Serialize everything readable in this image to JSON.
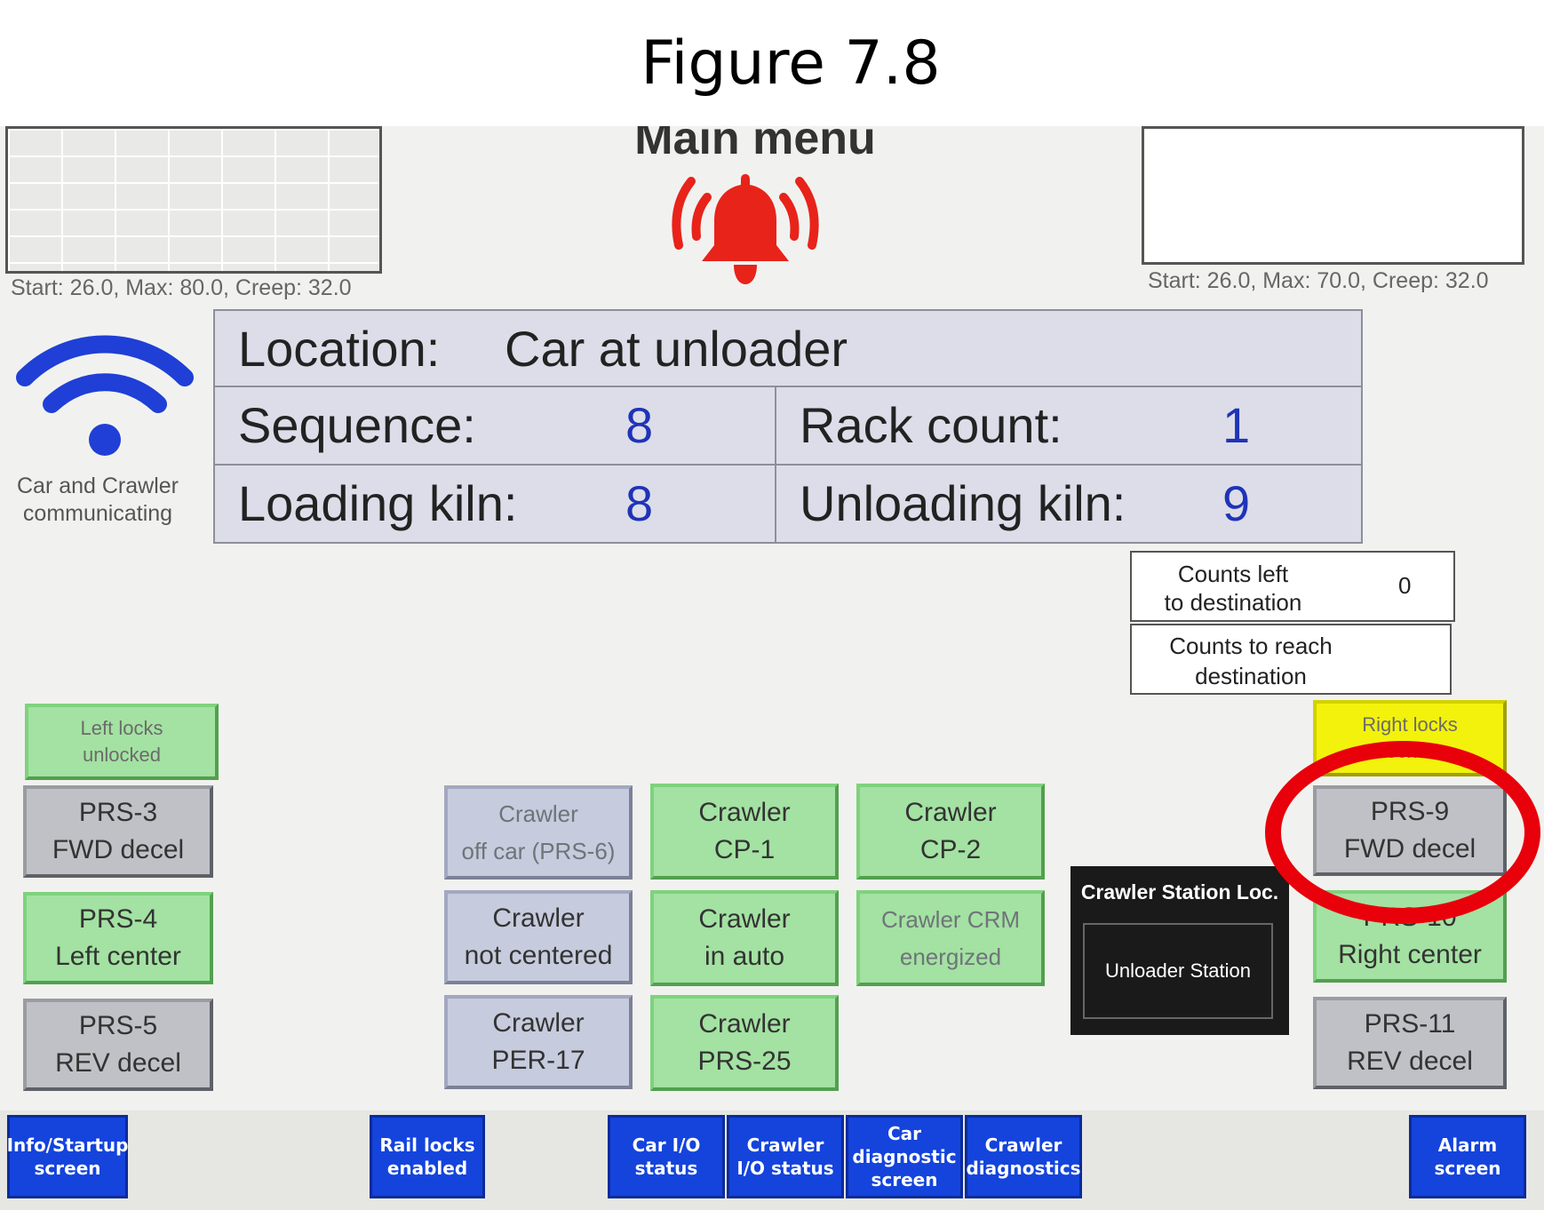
{
  "figure_caption": "Figure 7.8",
  "header": {
    "title": "Main menu"
  },
  "trends": {
    "left": {
      "scale": "Start: 26.0, Max: 80.0, Creep: 32.0"
    },
    "right": {
      "scale": "Start: 26.0, Max: 70.0, Creep: 32.0"
    }
  },
  "comm_status": {
    "label_line1": "Car and Crawler",
    "label_line2": "communicating"
  },
  "info": {
    "location_label": "Location:",
    "location_value": "Car at unloader",
    "sequence_label": "Sequence:",
    "sequence_value": "8",
    "rack_count_label": "Rack count:",
    "rack_count_value": "1",
    "loading_kiln_label": "Loading kiln:",
    "loading_kiln_value": "8",
    "unloading_kiln_label": "Unloading kiln:",
    "unloading_kiln_value": "9"
  },
  "counts": {
    "left_label_line1": "Counts left",
    "left_label_line2": "to destination",
    "left_value": "0",
    "reach_label_line1": "Counts to reach",
    "reach_label_line2": "destination"
  },
  "locks": {
    "left_line1": "Left locks",
    "left_line2": "unlocked",
    "right_line1": "Right locks",
    "right_line2": "locked"
  },
  "left_sensors": [
    {
      "line1": "PRS-3",
      "line2": "FWD decel"
    },
    {
      "line1": "PRS-4",
      "line2": "Left center"
    },
    {
      "line1": "PRS-5",
      "line2": "REV decel"
    }
  ],
  "right_sensors": [
    {
      "line1": "PRS-9",
      "line2": "FWD decel"
    },
    {
      "line1": "PRS-10",
      "line2": "Right center"
    },
    {
      "line1": "PRS-11",
      "line2": "REV decel"
    }
  ],
  "crawler": {
    "off_car": {
      "line1": "Crawler",
      "line2": "off car (PRS-6)"
    },
    "cp1": {
      "line1": "Crawler",
      "line2": "CP-1"
    },
    "cp2": {
      "line1": "Crawler",
      "line2": "CP-2"
    },
    "not_centered": {
      "line1": "Crawler",
      "line2": "not centered"
    },
    "in_auto": {
      "line1": "Crawler",
      "line2": "in auto"
    },
    "crm": {
      "line1": "Crawler CRM",
      "line2": "energized"
    },
    "per17": {
      "line1": "Crawler",
      "line2": "PER-17"
    },
    "prs25": {
      "line1": "Crawler",
      "line2": "PRS-25"
    }
  },
  "station": {
    "title": "Crawler Station Loc.",
    "value": "Unloader Station"
  },
  "nav": {
    "info_line1": "Info/Startup",
    "info_line2": "screen",
    "rail_line1": "Rail locks",
    "rail_line2": "enabled",
    "car_io_line1": "Car I/O",
    "car_io_line2": "status",
    "crawler_io_line1": "Crawler",
    "crawler_io_line2": "I/O status",
    "car_diag_line1": "Car",
    "car_diag_line2": "diagnostic",
    "car_diag_line3": "screen",
    "crawler_diag_line1": "Crawler",
    "crawler_diag_line2": "diagnostics",
    "alarm_line1": "Alarm",
    "alarm_line2": "screen"
  },
  "colors": {
    "alarm_red": "#e8231a",
    "wifi_blue": "#1f3fd6",
    "active_green": "#a3e2a2",
    "inactive_gray": "#bfc1c6",
    "locked_yellow": "#f2f20c",
    "nav_blue": "#1444dc",
    "highlight_ring": "#e8000b"
  }
}
